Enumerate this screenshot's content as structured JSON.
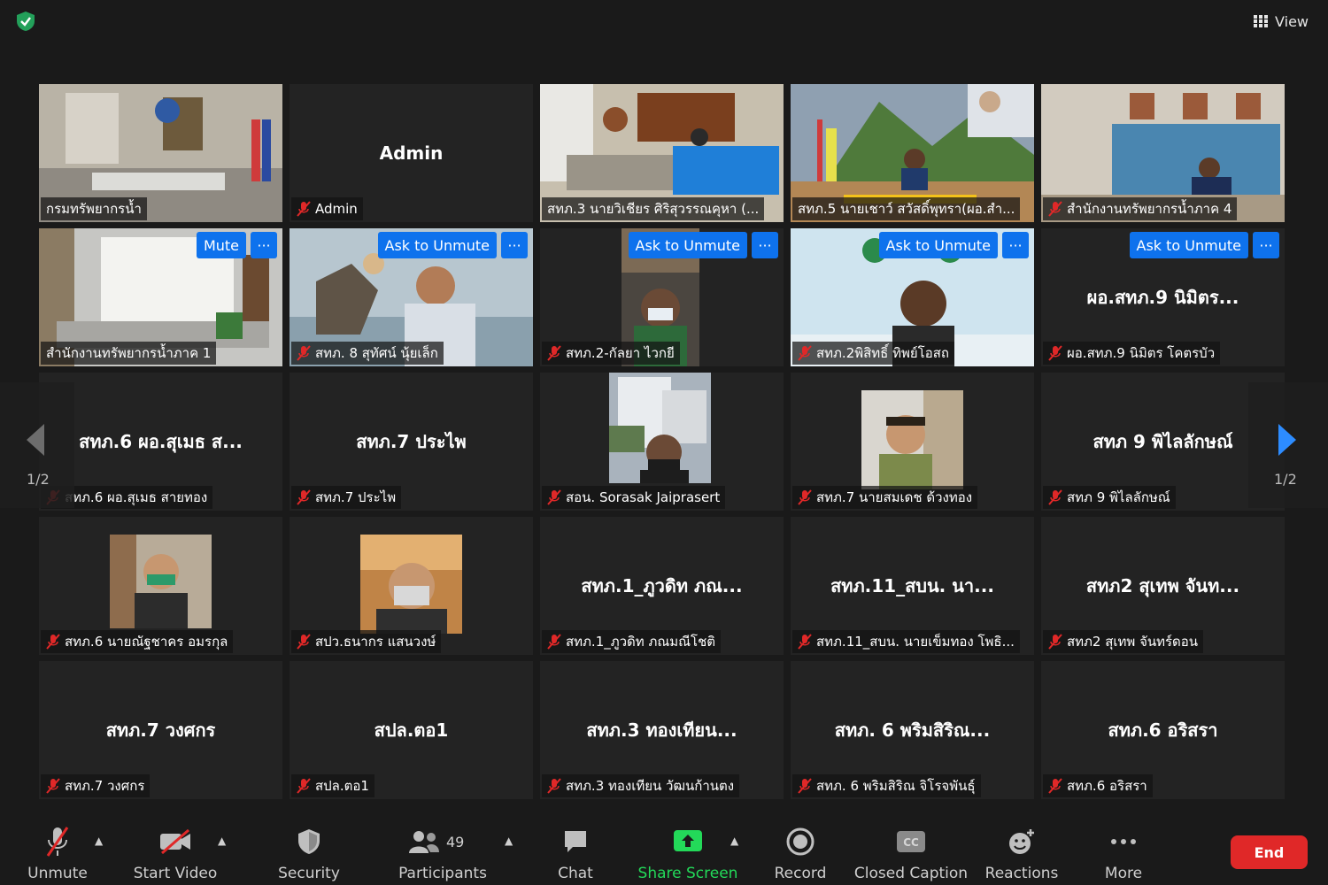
{
  "window": {
    "view_label": "View"
  },
  "page_indicator": {
    "left": "1/2",
    "right": "1/2"
  },
  "tiles": [
    {
      "name": "กรมทรัพยากรน้ำ",
      "type": "video",
      "muted": false
    },
    {
      "name": "Admin",
      "display_name": "Admin",
      "type": "name",
      "muted": true
    },
    {
      "name": "สทภ.3 นายวิเชียร ศิริสุวรรณคุหา (...",
      "type": "video",
      "muted": false
    },
    {
      "name": "สทภ.5 นายเชาว์ สวัสดิ์พุทรา(ผอ.สำ...",
      "type": "video",
      "muted": false,
      "active": true
    },
    {
      "name": "สำนักงานทรัพยากรน้ำภาค 4",
      "type": "video",
      "muted": true
    },
    {
      "name": "สำนักงานทรัพยากรน้ำภาค 1",
      "type": "video",
      "muted": false,
      "action": "Mute"
    },
    {
      "name": "สทภ. 8 สุทัศน์ นุ้ยเล็ก",
      "type": "video",
      "muted": true,
      "action": "Ask to Unmute"
    },
    {
      "name": "สทภ.2-กัลยา ไวกยี",
      "type": "video",
      "muted": true,
      "action": "Ask to Unmute"
    },
    {
      "name": "สทภ.2พิสิทธิ์ ทิพย์โอสถ",
      "type": "video",
      "muted": true,
      "action": "Ask to Unmute"
    },
    {
      "name": "ผอ.สทภ.9 นิมิตร โคตรบัว",
      "display_name": "ผอ.สทภ.9 นิมิตร...",
      "type": "name",
      "muted": true,
      "action": "Ask to Unmute"
    },
    {
      "name": "สทภ.6 ผอ.สุเมธ สายทอง",
      "display_name": "สทภ.6 ผอ.สุเมธ ส...",
      "type": "name",
      "muted": true
    },
    {
      "name": "สทภ.7 ประไพ",
      "display_name": "สทภ.7 ประไพ",
      "type": "name",
      "muted": true
    },
    {
      "name": "สอน. Sorasak Jaiprasert",
      "type": "avatar",
      "muted": true
    },
    {
      "name": "สทภ.7 นายสมเดช ด้วงทอง",
      "type": "avatar",
      "muted": true
    },
    {
      "name": "สทภ 9 พิไลลักษณ์",
      "display_name": "สทภ 9 พิไลลักษณ์",
      "type": "name",
      "muted": true
    },
    {
      "name": "สทภ.6 นายณัฐชาคร อมรกุล",
      "type": "avatar",
      "muted": true
    },
    {
      "name": "สปว.ธนากร แสนวงษ์",
      "type": "avatar",
      "muted": true
    },
    {
      "name": "สทภ.1_ภูวดิท ภณมณีโชติ",
      "display_name": "สทภ.1_ภูวดิท ภณ...",
      "type": "name",
      "muted": true
    },
    {
      "name": "สทภ.11_สบน. นายเข็มทอง โพธิ...",
      "display_name": "สทภ.11_สบน. นา...",
      "type": "name",
      "muted": true
    },
    {
      "name": "สทภ2 สุเทพ จันทร์ดอน",
      "display_name": "สทภ2 สุเทพ จันท...",
      "type": "name",
      "muted": true
    },
    {
      "name": "สทภ.7 วงศกร",
      "display_name": "สทภ.7 วงศกร",
      "type": "name",
      "muted": true
    },
    {
      "name": "สปล.ตอ1",
      "display_name": "สปล.ตอ1",
      "type": "name",
      "muted": true
    },
    {
      "name": "สทภ.3 ทองเทียน วัฒนก้านตง",
      "display_name": "สทภ.3 ทองเทียน...",
      "type": "name",
      "muted": true
    },
    {
      "name": "สทภ. 6 พริมสิริณ จิโรจพันธุ์",
      "display_name": "สทภ. 6 พริมสิริณ...",
      "type": "name",
      "muted": true
    },
    {
      "name": "สทภ.6 อริสรา",
      "display_name": "สทภ.6 อริสรา",
      "type": "name",
      "muted": true
    }
  ],
  "toolbar": {
    "unmute": "Unmute",
    "start_video": "Start Video",
    "security": "Security",
    "participants": "Participants",
    "participants_count": "49",
    "chat": "Chat",
    "share_screen": "Share Screen",
    "record": "Record",
    "closed_caption": "Closed Caption",
    "reactions": "Reactions",
    "more": "More",
    "end": "End"
  },
  "colors": {
    "accent_blue": "#0e72ed",
    "active_speaker": "#d7ea3a",
    "share_green": "#23d959",
    "end_red": "#e02828",
    "mic_off_red": "#e02828"
  }
}
